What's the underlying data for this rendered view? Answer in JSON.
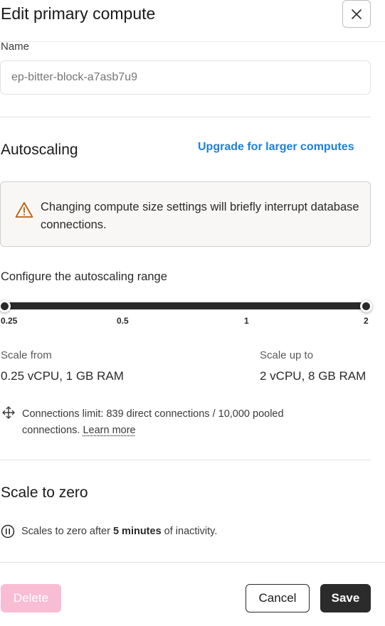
{
  "dialog": {
    "title": "Edit primary compute",
    "close_icon": "close-icon"
  },
  "name_field": {
    "label": "Name",
    "value": "",
    "placeholder": "ep-bitter-block-a7asb7u9"
  },
  "autoscaling": {
    "title": "Autoscaling",
    "upgrade_link": "Upgrade for larger computes",
    "alert": {
      "icon": "warning-icon",
      "text": "Changing compute size settings will briefly interrupt database connections."
    },
    "range_label": "Configure the autoscaling range",
    "slider": {
      "ticks": [
        "0.25",
        "0.5",
        "1",
        "2"
      ],
      "min_value": 0.25,
      "max_value": 2
    },
    "scale_from": {
      "label": "Scale from",
      "value": "0.25 vCPU, 1 GB RAM"
    },
    "scale_up_to": {
      "label": "Scale up to",
      "value": "2 vCPU, 8 GB RAM"
    },
    "connections": {
      "icon": "connections-icon",
      "text": "Connections limit: 839 direct connections / 10,000 pooled connections.",
      "link": "Learn more"
    }
  },
  "scale_to_zero": {
    "title": "Scale to zero",
    "icon": "pause-icon",
    "text_before": "Scales to zero after",
    "duration": "5 minutes",
    "text_after": "of inactivity."
  },
  "footer": {
    "delete_label": "Delete",
    "cancel_label": "Cancel",
    "save_label": "Save"
  },
  "colors": {
    "link": "#1e7fd9",
    "delete_disabled": "#f9bdd3",
    "save": "#2b2b2b",
    "alert_bg": "#f8f7f6"
  }
}
